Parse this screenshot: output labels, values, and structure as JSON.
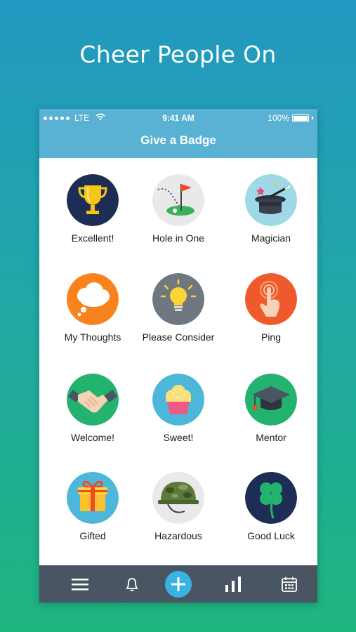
{
  "headline": "Cheer People On",
  "status_bar": {
    "carrier": "LTE",
    "time": "9:41 AM",
    "battery": "100%"
  },
  "nav": {
    "title": "Give a Badge"
  },
  "badges": [
    {
      "label": "Excellent!",
      "icon": "trophy-icon",
      "color": "#1e2d55"
    },
    {
      "label": "Hole in One",
      "icon": "golf-flag-icon",
      "color": "#e9e9e9"
    },
    {
      "label": "Magician",
      "icon": "magic-hat-icon",
      "color": "#9fd8e6"
    },
    {
      "label": "My Thoughts",
      "icon": "thought-bubble-icon",
      "color": "#f7821e"
    },
    {
      "label": "Please Consider",
      "icon": "lightbulb-icon",
      "color": "#6f7780"
    },
    {
      "label": "Ping",
      "icon": "tap-finger-icon",
      "color": "#ee5a2b"
    },
    {
      "label": "Welcome!",
      "icon": "handshake-icon",
      "color": "#24b36f"
    },
    {
      "label": "Sweet!",
      "icon": "cupcake-icon",
      "color": "#4db7da"
    },
    {
      "label": "Mentor",
      "icon": "graduation-cap-icon",
      "color": "#24b36f"
    },
    {
      "label": "Gifted",
      "icon": "gift-icon",
      "color": "#4db7da"
    },
    {
      "label": "Hazardous",
      "icon": "helmet-icon",
      "color": "#e9e9e9"
    },
    {
      "label": "Good Luck",
      "icon": "clover-icon",
      "color": "#1e2d55"
    }
  ],
  "tabbar": {
    "items": [
      "menu-icon",
      "bell-icon",
      "add-icon",
      "stats-icon",
      "calendar-icon"
    ],
    "accent": "#3ab3e0"
  }
}
